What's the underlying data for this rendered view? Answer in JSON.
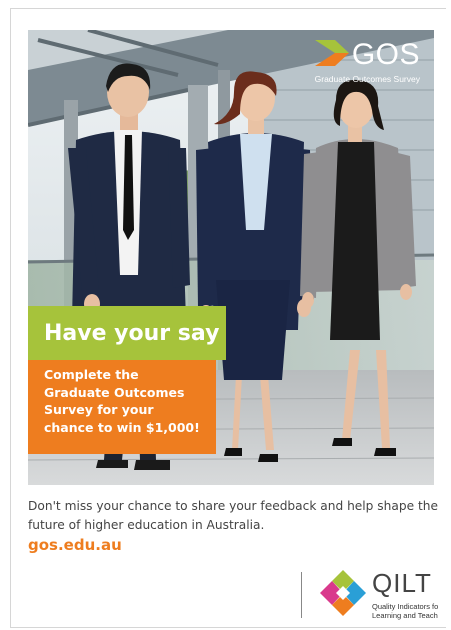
{
  "brand": {
    "name": "GOS",
    "tagline": "Graduate Outcomes Survey"
  },
  "headline": "Have your say",
  "promo_lines": [
    "Complete the",
    "Graduate Outcomes",
    "Survey for your",
    "chance to win $1,000!"
  ],
  "body_lines": [
    "Don't miss your chance to share your feedback and help shape the",
    "future of higher education in Australia."
  ],
  "url": "gos.edu.au",
  "partner": {
    "name": "QILT",
    "tagline_lines": [
      "Quality Indicators fo",
      "Learning and Teachi"
    ]
  },
  "colors": {
    "green": "#a6c33b",
    "orange": "#ee7d1f",
    "body_text": "#444444"
  }
}
